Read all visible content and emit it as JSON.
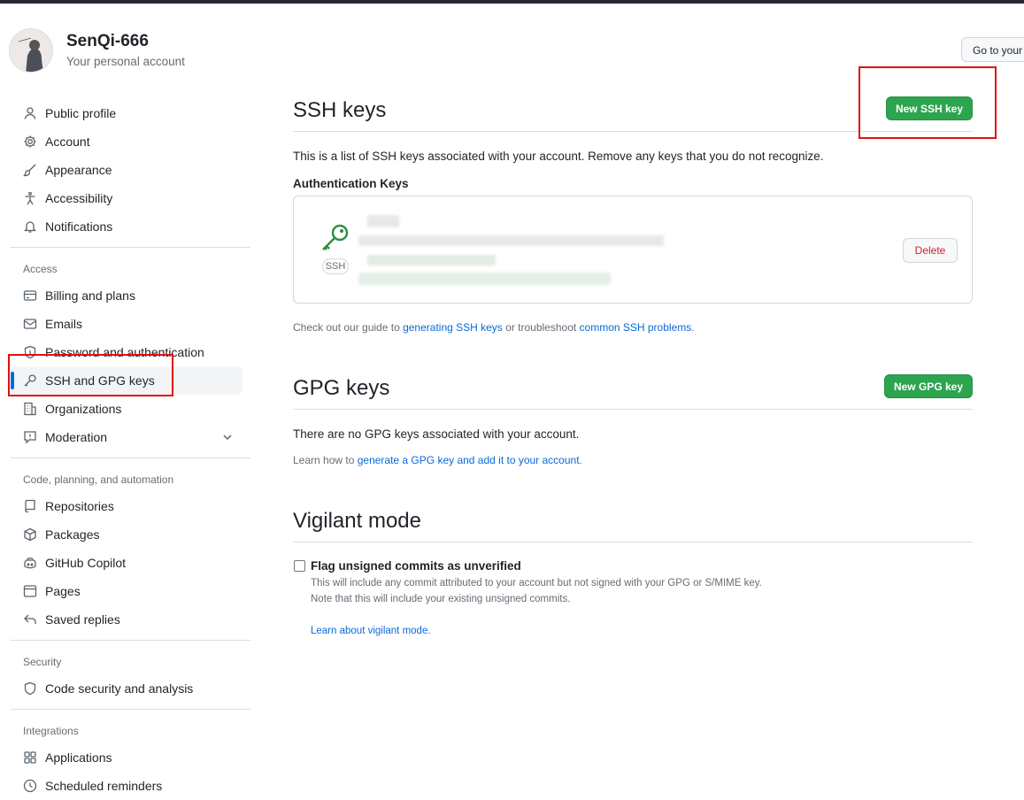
{
  "user": {
    "name": "SenQi-666",
    "subtitle": "Your personal account",
    "goto_label": "Go to your personal profile"
  },
  "sidebar": {
    "items1": [
      {
        "label": "Public profile",
        "icon": "person-icon"
      },
      {
        "label": "Account",
        "icon": "gear-icon"
      },
      {
        "label": "Appearance",
        "icon": "paintbrush-icon"
      },
      {
        "label": "Accessibility",
        "icon": "accessibility-icon"
      },
      {
        "label": "Notifications",
        "icon": "bell-icon"
      }
    ],
    "access_heading": "Access",
    "access_items": [
      {
        "label": "Billing and plans",
        "icon": "credit-card-icon"
      },
      {
        "label": "Emails",
        "icon": "mail-icon"
      },
      {
        "label": "Password and authentication",
        "icon": "shield-lock-icon"
      },
      {
        "label": "SSH and GPG keys",
        "icon": "key-icon"
      },
      {
        "label": "Organizations",
        "icon": "organization-icon"
      },
      {
        "label": "Moderation",
        "icon": "report-icon"
      }
    ],
    "code_heading": "Code, planning, and automation",
    "code_items": [
      {
        "label": "Repositories",
        "icon": "repo-icon"
      },
      {
        "label": "Packages",
        "icon": "package-icon"
      },
      {
        "label": "GitHub Copilot",
        "icon": "copilot-icon"
      },
      {
        "label": "Pages",
        "icon": "browser-icon"
      },
      {
        "label": "Saved replies",
        "icon": "reply-icon"
      }
    ],
    "security_heading": "Security",
    "security_items": [
      {
        "label": "Code security and analysis",
        "icon": "shield-icon"
      }
    ],
    "integrations_heading": "Integrations",
    "integrations_items": [
      {
        "label": "Applications",
        "icon": "apps-icon"
      },
      {
        "label": "Scheduled reminders",
        "icon": "clock-icon"
      }
    ]
  },
  "ssh": {
    "title": "SSH keys",
    "new_button": "New SSH key",
    "description": "This is a list of SSH keys associated with your account. Remove any keys that you do not recognize.",
    "auth_heading": "Authentication Keys",
    "badge": "SSH",
    "delete_button": "Delete",
    "guide_prefix": "Check out our guide to ",
    "guide_link1": "generating SSH keys",
    "guide_middle": " or troubleshoot ",
    "guide_link2": "common SSH problems",
    "guide_suffix": "."
  },
  "gpg": {
    "title": "GPG keys",
    "new_button": "New GPG key",
    "empty_text": "There are no GPG keys associated with your account.",
    "learn_prefix": "Learn how to ",
    "learn_link": "generate a GPG key and add it to your account",
    "learn_suffix": "."
  },
  "vigilant": {
    "title": "Vigilant mode",
    "checkbox_label": "Flag unsigned commits as unverified",
    "help1": "This will include any commit attributed to your account but not signed with your GPG or S/MIME key.",
    "help2": "Note that this will include your existing unsigned commits.",
    "learn_link": "Learn about vigilant mode."
  }
}
